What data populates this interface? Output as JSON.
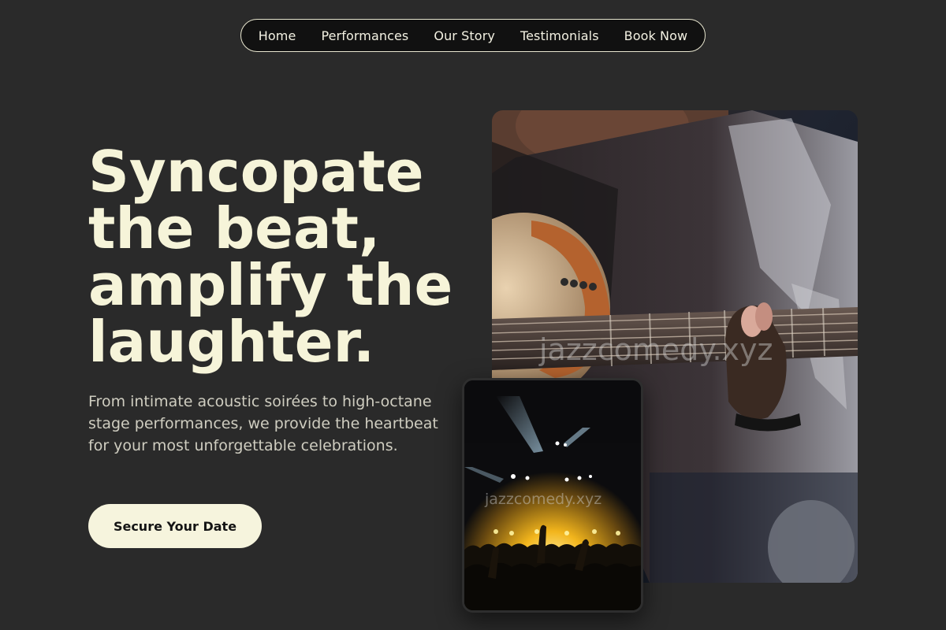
{
  "nav": {
    "items": [
      "Home",
      "Performances",
      "Our Story",
      "Testimonials",
      "Book Now"
    ]
  },
  "hero": {
    "headline": "Syncopate the beat, amplify the laughter.",
    "subtext": "From intimate acoustic soirées to high-octane stage performances, we provide the heartbeat for your most unforgettable celebrations.",
    "cta_label": "Secure Your Date"
  },
  "images": {
    "main_watermark": "jazzcomedy.xyz",
    "small_watermark": "jazzcomedy.xyz",
    "main_subject": "guitarist playing acoustic guitar",
    "small_subject": "concert crowd under stage lights"
  },
  "colors": {
    "background": "#2a2a2a",
    "accent_cream": "#f6f4dd",
    "nav_bg": "#111111",
    "stage_glow": "#f2b51c"
  }
}
